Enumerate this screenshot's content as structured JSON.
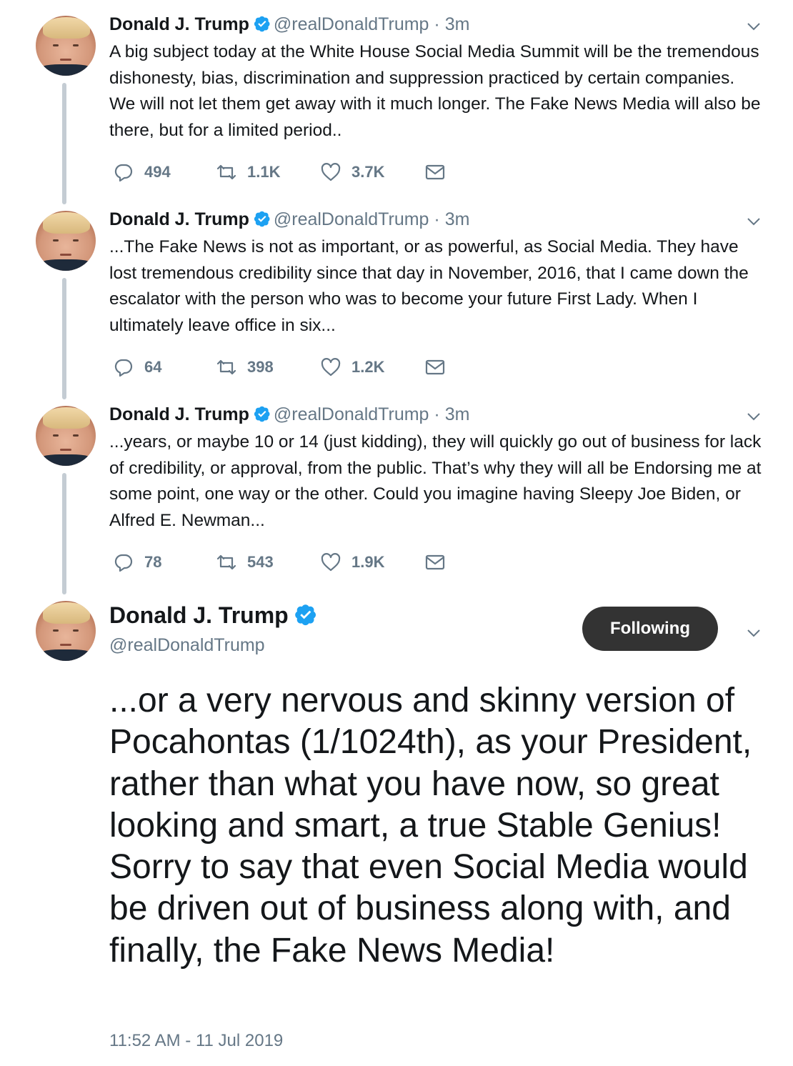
{
  "thread": [
    {
      "name": "Donald J. Trump",
      "handle": "@realDonaldTrump",
      "separator": "·",
      "time": "3m",
      "text": "A big subject today at the White House Social Media Summit will be the tremendous dishonesty, bias, discrimination and suppression practiced by certain companies. We will not let them get away with it much longer. The Fake News Media will also be there, but for a limited period..",
      "replies": "494",
      "retweets": "1.1K",
      "likes": "3.7K"
    },
    {
      "name": "Donald J. Trump",
      "handle": "@realDonaldTrump",
      "separator": "·",
      "time": "3m",
      "text": "...The Fake News is not as important, or as powerful, as Social Media. They have lost tremendous credibility since that day in November, 2016, that I came down the escalator with the person who was to become your future First Lady. When I ultimately leave office in six...",
      "replies": "64",
      "retweets": "398",
      "likes": "1.2K"
    },
    {
      "name": "Donald J. Trump",
      "handle": "@realDonaldTrump",
      "separator": "·",
      "time": "3m",
      "text": "...years, or maybe 10 or 14 (just kidding), they will quickly go out of business for lack of credibility, or approval, from the public. That’s why they will all be Endorsing me at some point, one way or the other. Could you imagine having Sleepy Joe Biden, or Alfred E. Newman...",
      "replies": "78",
      "retweets": "543",
      "likes": "1.9K"
    }
  ],
  "main_tweet": {
    "name": "Donald J. Trump",
    "handle": "@realDonaldTrump",
    "follow_label": "Following",
    "text": "...or a very nervous and skinny version of Pocahontas (1/1024th), as your President, rather than what you have now, so great looking and smart, a true Stable Genius! Sorry to say that even Social Media would be driven out of business along with, and finally, the Fake News Media!",
    "timestamp": "11:52 AM - 11 Jul 2019"
  },
  "colors": {
    "verified": "#1da1f2",
    "muted": "#657786",
    "thread_line": "#c4ccd3",
    "button": "#333333"
  },
  "icons": [
    "reply-icon",
    "retweet-icon",
    "like-icon",
    "direct-message-icon",
    "chevron-down-icon",
    "verified-badge-icon"
  ]
}
